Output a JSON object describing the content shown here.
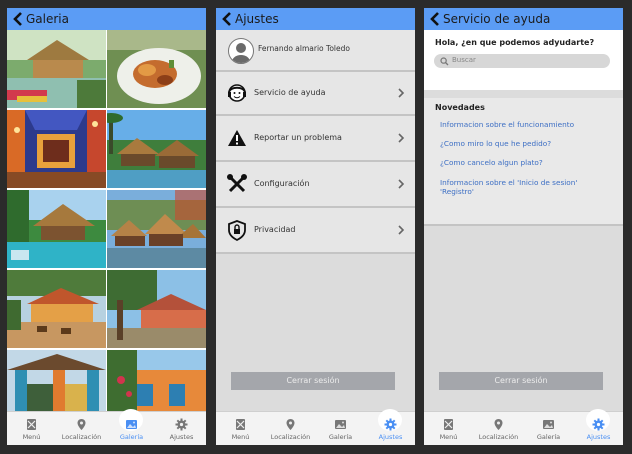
{
  "colors": {
    "topbar": "#5b9cf5",
    "accent": "#4a8ff3",
    "link": "#3d6fc4",
    "logout": "#a4a6ab"
  },
  "nav": {
    "menu": "Menú",
    "location": "Localización",
    "gallery": "Galería",
    "settings": "Ajustes"
  },
  "gallery": {
    "title": "Galeria",
    "active_tab": "gallery"
  },
  "settings": {
    "title": "Ajustes",
    "user_name": "Fernando almario Toledo",
    "items": [
      {
        "label": "Servicio de ayuda",
        "icon": "support-agent-icon"
      },
      {
        "label": "Reportar un problema",
        "icon": "warning-icon"
      },
      {
        "label": "Configuración",
        "icon": "tools-icon"
      },
      {
        "label": "Privacidad",
        "icon": "shield-lock-icon"
      }
    ],
    "logout": "Cerrar sesión",
    "active_tab": "settings"
  },
  "help": {
    "title": "Servicio de ayuda",
    "question": "Hola, ¿en que podemos adyudarte?",
    "search_placeholder": "Buscar",
    "news_header": "Novedades",
    "links": [
      "Informacion sobre el funcionamiento",
      "¿Como miro lo que he pedido?",
      "¿Como cancelo algun plato?",
      "Informacion sobre el 'Inicio de sesion' 'Registro'"
    ],
    "logout": "Cerrar sesión",
    "active_tab": "settings"
  }
}
